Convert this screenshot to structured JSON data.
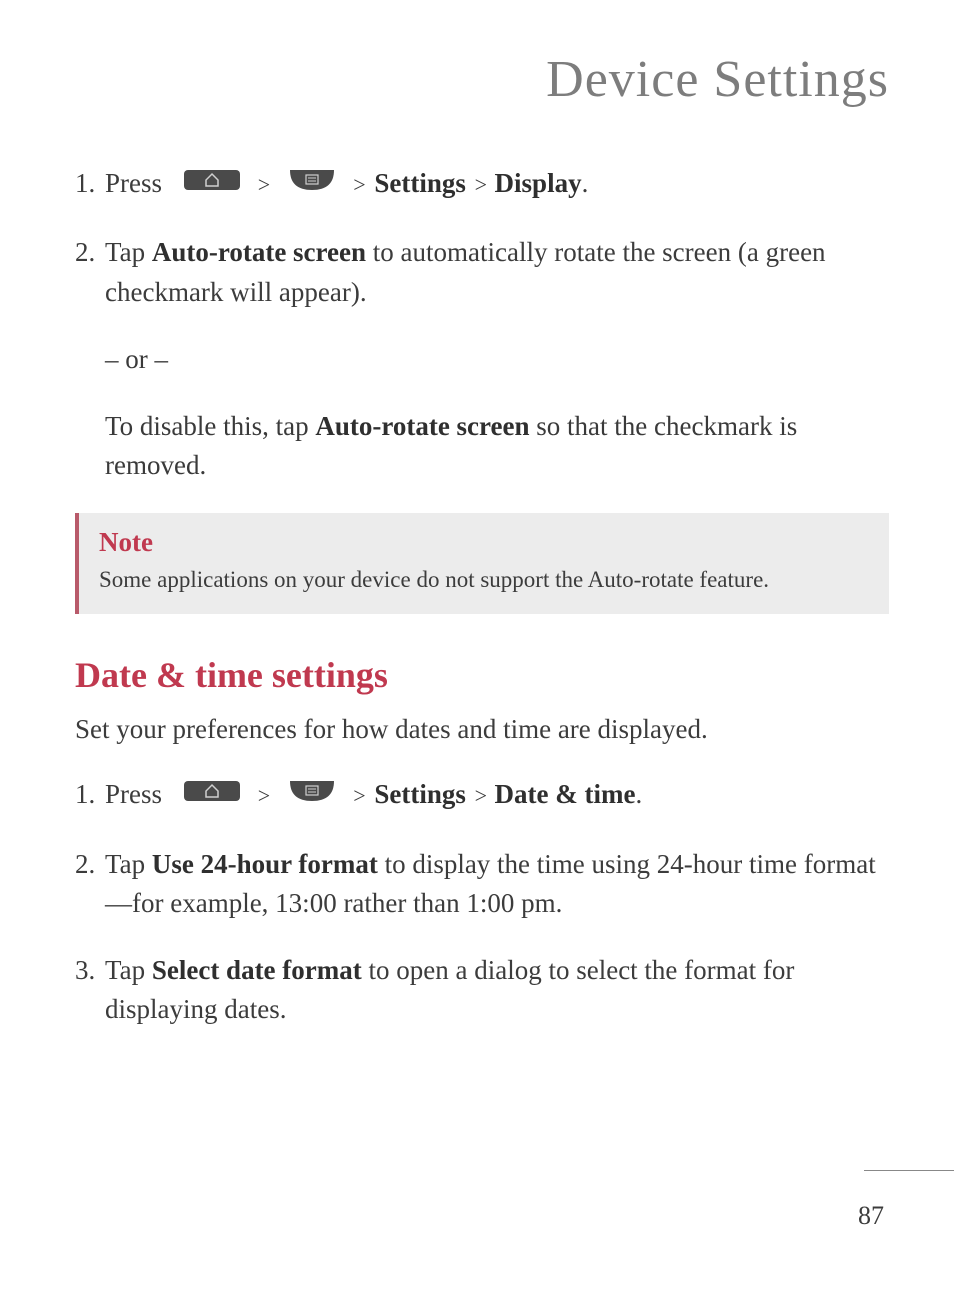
{
  "header": {
    "title": "Device Settings"
  },
  "section1": {
    "step1_prefix": "1.",
    "step1_press": "Press",
    "step1_settings": "Settings",
    "step1_display": "Display",
    "step2_prefix": "2.",
    "step2_tap": "Tap ",
    "step2_bold": "Auto-rotate screen",
    "step2_rest": " to automatically rotate the screen (a green checkmark will appear).",
    "or": "– or –",
    "disable_a": "To disable this, tap ",
    "disable_bold": "Auto-rotate screen",
    "disable_b": " so that the checkmark is removed."
  },
  "note": {
    "title": "Note",
    "body": "Some applications on your device do not support the Auto-rotate feature."
  },
  "section2": {
    "title": "Date & time settings",
    "intro": "Set your preferences for how dates and time are displayed.",
    "step1_prefix": "1.",
    "step1_press": "Press",
    "step1_settings": "Settings",
    "step1_datetime": "Date & time",
    "step2_prefix": "2.",
    "step2_tap": "Tap ",
    "step2_bold": "Use 24-hour format",
    "step2_rest": " to display the time using 24-hour time format—for example, 13:00 rather than 1:00 pm.",
    "step3_prefix": "3.",
    "step3_tap": "Tap ",
    "step3_bold": "Select date format",
    "step3_rest": " to open a dialog to select the format for displaying dates."
  },
  "footer": {
    "page_number": "87"
  },
  "symbols": {
    "gt": ">",
    "period": "."
  }
}
